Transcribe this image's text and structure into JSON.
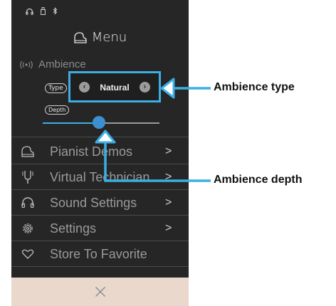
{
  "menu": {
    "title": "Menu"
  },
  "ambience": {
    "label": "Ambience",
    "type_pill": "Type",
    "depth_pill": "Depth",
    "type_value": "Natural",
    "depth_level_fraction": 0.48
  },
  "menu_items": [
    {
      "label": "Pianist Demos",
      "icon": "piano-icon",
      "has_chevron": true
    },
    {
      "label": "Virtual Technician",
      "icon": "tuning-fork-icon",
      "has_chevron": true
    },
    {
      "label": "Sound Settings",
      "icon": "headphones-icon",
      "has_chevron": true
    },
    {
      "label": "Settings",
      "icon": "gear-icon",
      "has_chevron": true
    },
    {
      "label": "Store To Favorite",
      "icon": "heart-icon",
      "has_chevron": false
    }
  ],
  "chevron_glyph": ">",
  "callouts": {
    "ambience_type": "Ambience type",
    "ambience_depth": "Ambience depth"
  },
  "colors": {
    "accent_blue": "#3daee3",
    "panel_bg": "#262626",
    "bottom_bar": "#ebd8cc"
  }
}
